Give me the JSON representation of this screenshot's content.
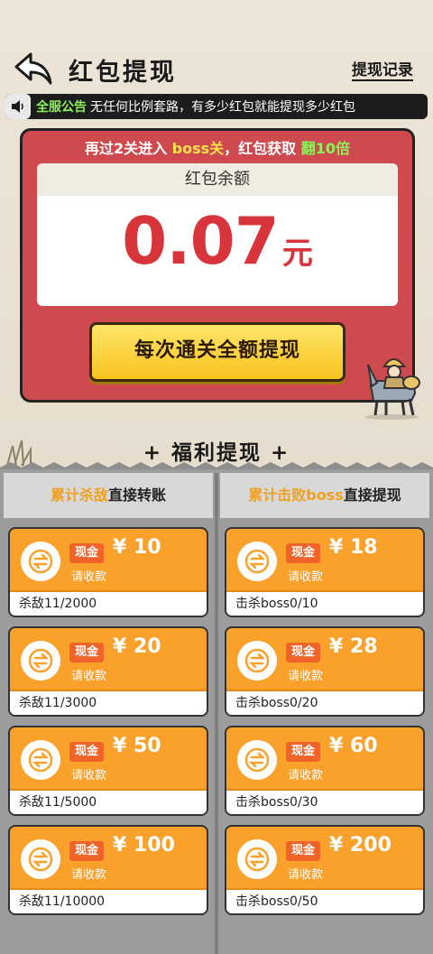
{
  "header": {
    "title": "红包提现",
    "record_link": "提现记录"
  },
  "notice": {
    "tag": "全服公告",
    "text": "无任何比例套路，有多少红包就能提现多少红包"
  },
  "promo": {
    "prefix": "再过2关进入",
    "boss": "boss关",
    "middle": "，红包获取",
    "bonus": "翻10倍"
  },
  "balance": {
    "label": "红包余额",
    "amount": "0.07",
    "unit": "元"
  },
  "withdraw_button": "每次通关全额提现",
  "welfare": {
    "plus_left": "+",
    "title": "福利提现",
    "plus_right": "+"
  },
  "columns": {
    "left": {
      "highlight": "累计杀敌",
      "rest": "直接转账"
    },
    "right": {
      "highlight": "累计击败boss",
      "rest": "直接提现"
    }
  },
  "card_common": {
    "cash_label": "现金",
    "collect_label": "请收款"
  },
  "kill_rewards": [
    {
      "amount": "¥ 10",
      "progress": "杀敌11/2000"
    },
    {
      "amount": "¥ 20",
      "progress": "杀敌11/3000"
    },
    {
      "amount": "¥ 50",
      "progress": "杀敌11/5000"
    },
    {
      "amount": "¥ 100",
      "progress": "杀敌11/10000"
    }
  ],
  "boss_rewards": [
    {
      "amount": "¥ 18",
      "progress": "击杀boss0/10"
    },
    {
      "amount": "¥ 28",
      "progress": "击杀boss0/20"
    },
    {
      "amount": "¥ 60",
      "progress": "击杀boss0/30"
    },
    {
      "amount": "¥ 200",
      "progress": "击杀boss0/50"
    }
  ],
  "colors": {
    "red_panel": "#cf4a4e",
    "card_orange": "#f9a12a",
    "cash_tag": "#f0642a",
    "accent_green": "#8cf25a",
    "accent_yellow": "#ffe14a",
    "balance_red": "#d7343b"
  },
  "icons": [
    "back-arrow-icon",
    "speaker-icon",
    "transfer-icon"
  ]
}
